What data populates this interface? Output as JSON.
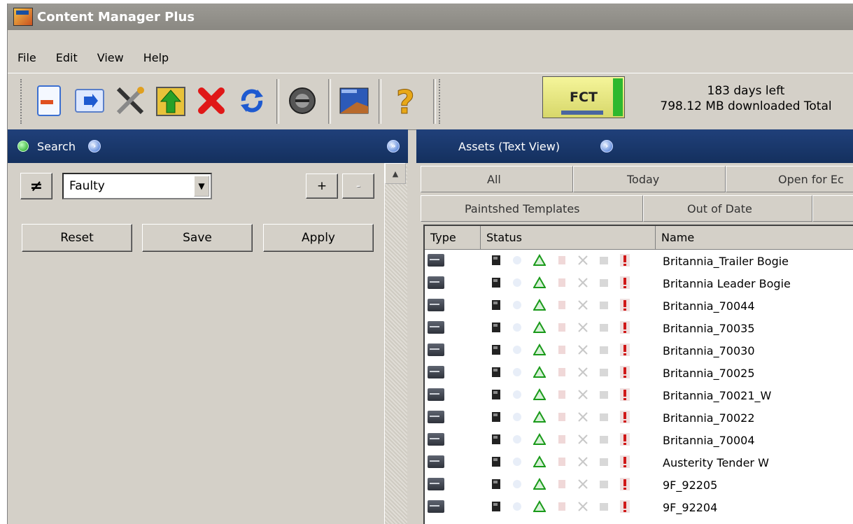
{
  "window": {
    "title": "Content Manager Plus"
  },
  "menu": [
    "File",
    "Edit",
    "View",
    "Help"
  ],
  "toolbar": {
    "buttons": [
      "new-asset-icon",
      "import-icon",
      "tools-icon",
      "upload-icon",
      "delete-icon",
      "refresh-icon",
      "speaker-icon",
      "map-icon",
      "help-icon"
    ],
    "fct_label": "FCT",
    "days_left": "183 days left",
    "downloaded": "798.12 MB downloaded Total"
  },
  "search_panel": {
    "title": "Search",
    "filter_operator": "≠",
    "filter_value": "Faulty",
    "add_label": "+",
    "remove_label": "-",
    "reset_label": "Reset",
    "save_label": "Save",
    "apply_label": "Apply"
  },
  "assets_panel": {
    "title": "Assets (Text View)",
    "tabs_row1": [
      "All",
      "Today",
      "Open for Ec"
    ],
    "tabs_row2": [
      "Paintshed Templates",
      "Out of Date"
    ],
    "columns": [
      "Type",
      "Status",
      "Name"
    ],
    "rows": [
      "Britannia_Trailer Bogie",
      "Britannia Leader Bogie",
      "Britannia_70044",
      "Britannia_70035",
      "Britannia_70030",
      "Britannia_70025",
      "Britannia_70021_W",
      "Britannia_70022",
      "Britannia_70004",
      "Austerity Tender W",
      "9F_92205",
      "9F_92204"
    ]
  }
}
